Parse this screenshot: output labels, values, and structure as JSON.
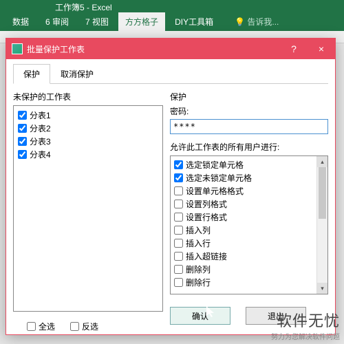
{
  "app": {
    "title": "工作簿5 - Excel"
  },
  "ribbon": {
    "tabs": {
      "t0": "数据",
      "t1": "6 审阅",
      "t2": "7 视图",
      "t3": "方方格子",
      "t4": "DIY工具箱"
    },
    "tell_me_icon": "💡",
    "tell_me": "告诉我..."
  },
  "dialog": {
    "title": "批量保护工作表",
    "help": "?",
    "close": "×",
    "tabs": {
      "protect": "保护",
      "unprotect": "取消保护"
    },
    "left": {
      "group_label": "未保护的工作表",
      "items": {
        "i0": "分表1",
        "i1": "分表2",
        "i2": "分表3",
        "i3": "分表4"
      },
      "select_all": "全选",
      "invert": "反选"
    },
    "right": {
      "group_label": "保护",
      "password_label": "密码:",
      "password_value": "****",
      "permit_label": "允许此工作表的所有用户进行:",
      "permits": {
        "p0": "选定锁定单元格",
        "p1": "选定未锁定单元格",
        "p2": "设置单元格格式",
        "p3": "设置列格式",
        "p4": "设置行格式",
        "p5": "插入列",
        "p6": "插入行",
        "p7": "插入超链接",
        "p8": "删除列",
        "p9": "删除行"
      },
      "ok": "确认",
      "cancel": "退出"
    }
  },
  "watermark": {
    "main": "软件无忧",
    "sub": "努力为您解决软件问题"
  }
}
